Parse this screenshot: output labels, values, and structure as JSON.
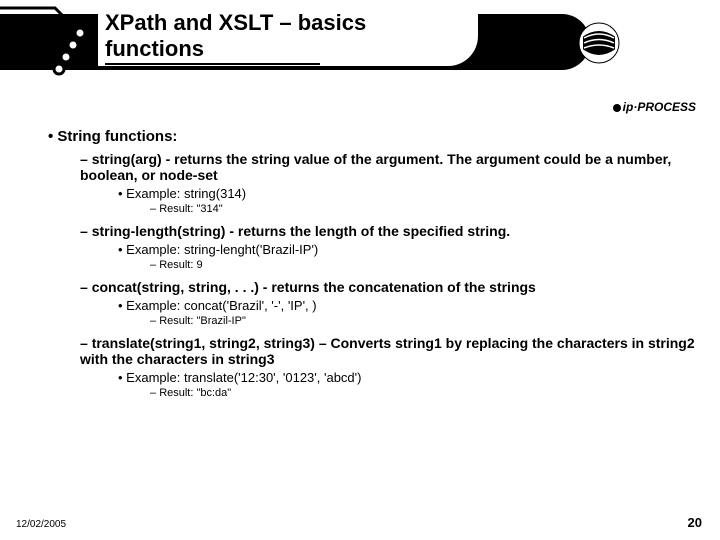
{
  "title_line1": "XPath and XSLT – basics",
  "title_line2": "functions",
  "logo_text": "ip·PROCESS",
  "section_heading": "String functions:",
  "items": [
    {
      "desc": "string(arg) - returns the string value of the argument. The argument could be a number, boolean, or node-set",
      "example": "Example: string(314)",
      "result": "Result: \"314\""
    },
    {
      "desc": "string-length(string) - returns the length of the specified string.",
      "example": "Example: string-lenght('Brazil-IP')",
      "result": "Result: 9"
    },
    {
      "desc": "concat(string, string, . . .) - returns the concatenation of the strings",
      "example": "Example: concat('Brazil', '-', 'IP', )",
      "result": "Result: \"Brazil-IP\""
    },
    {
      "desc": "translate(string1, string2, string3) – Converts string1 by replacing the characters in string2 with the characters in string3",
      "example": "Example: translate('12:30', '0123', 'abcd')",
      "result": "Result: \"bc:da\""
    }
  ],
  "footer_date": "12/02/2005",
  "footer_page": "20"
}
